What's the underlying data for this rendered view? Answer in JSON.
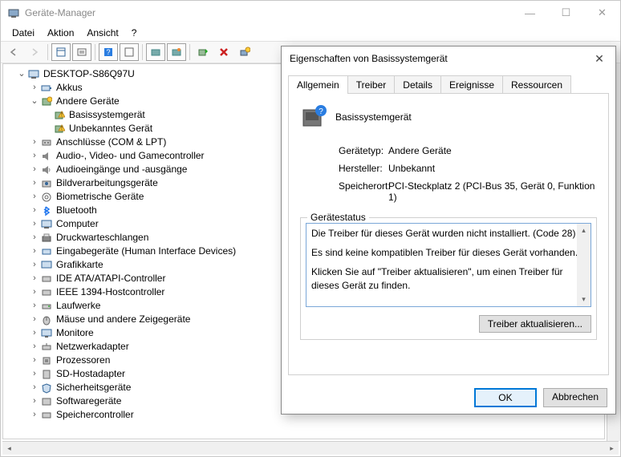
{
  "window": {
    "title": "Geräte-Manager",
    "controls": {
      "min": "—",
      "max": "☐",
      "close": "✕"
    }
  },
  "menu": [
    "Datei",
    "Aktion",
    "Ansicht",
    "?"
  ],
  "tree": {
    "root": "DESKTOP-S86Q97U",
    "akkus": "Akkus",
    "andere": "Andere Geräte",
    "basis": "Basissystemgerät",
    "unbekannt": "Unbekanntes Gerät",
    "anschluesse": "Anschlüsse (COM & LPT)",
    "audio": "Audio-, Video- und Gamecontroller",
    "audioio": "Audioeingänge und -ausgänge",
    "bildv": "Bildverarbeitungsgeräte",
    "biom": "Biometrische Geräte",
    "bluetooth": "Bluetooth",
    "computer": "Computer",
    "druck": "Druckwarteschlangen",
    "hid": "Eingabegeräte (Human Interface Devices)",
    "grafik": "Grafikkarte",
    "ide": "IDE ATA/ATAPI-Controller",
    "ieee": "IEEE 1394-Hostcontroller",
    "laufwerke": "Laufwerke",
    "maus": "Mäuse und andere Zeigegeräte",
    "monitore": "Monitore",
    "netz": "Netzwerkadapter",
    "proz": "Prozessoren",
    "sd": "SD-Hostadapter",
    "sicher": "Sicherheitsgeräte",
    "software": "Softwaregeräte",
    "speicher": "Speichercontroller"
  },
  "dialog": {
    "title": "Eigenschaften von Basissystemgerät",
    "tabs": {
      "allgemein": "Allgemein",
      "treiber": "Treiber",
      "details": "Details",
      "ereignisse": "Ereignisse",
      "ressourcen": "Ressourcen"
    },
    "device_name": "Basissystemgerät",
    "rows": {
      "type_label": "Gerätetyp:",
      "type_value": "Andere Geräte",
      "vendor_label": "Hersteller:",
      "vendor_value": "Unbekannt",
      "loc_label": "Speicherort:",
      "loc_value": "PCI-Steckplatz 2 (PCI-Bus 35, Gerät 0, Funktion 1)"
    },
    "status_legend": "Gerätestatus",
    "status_text_1": "Die Treiber für dieses Gerät wurden nicht installiert. (Code 28)",
    "status_text_2": "Es sind keine kompatiblen Treiber für dieses Gerät vorhanden.",
    "status_text_3": "Klicken Sie auf \"Treiber aktualisieren\", um einen Treiber für dieses Gerät zu finden.",
    "update_btn": "Treiber aktualisieren...",
    "ok": "OK",
    "cancel": "Abbrechen"
  }
}
